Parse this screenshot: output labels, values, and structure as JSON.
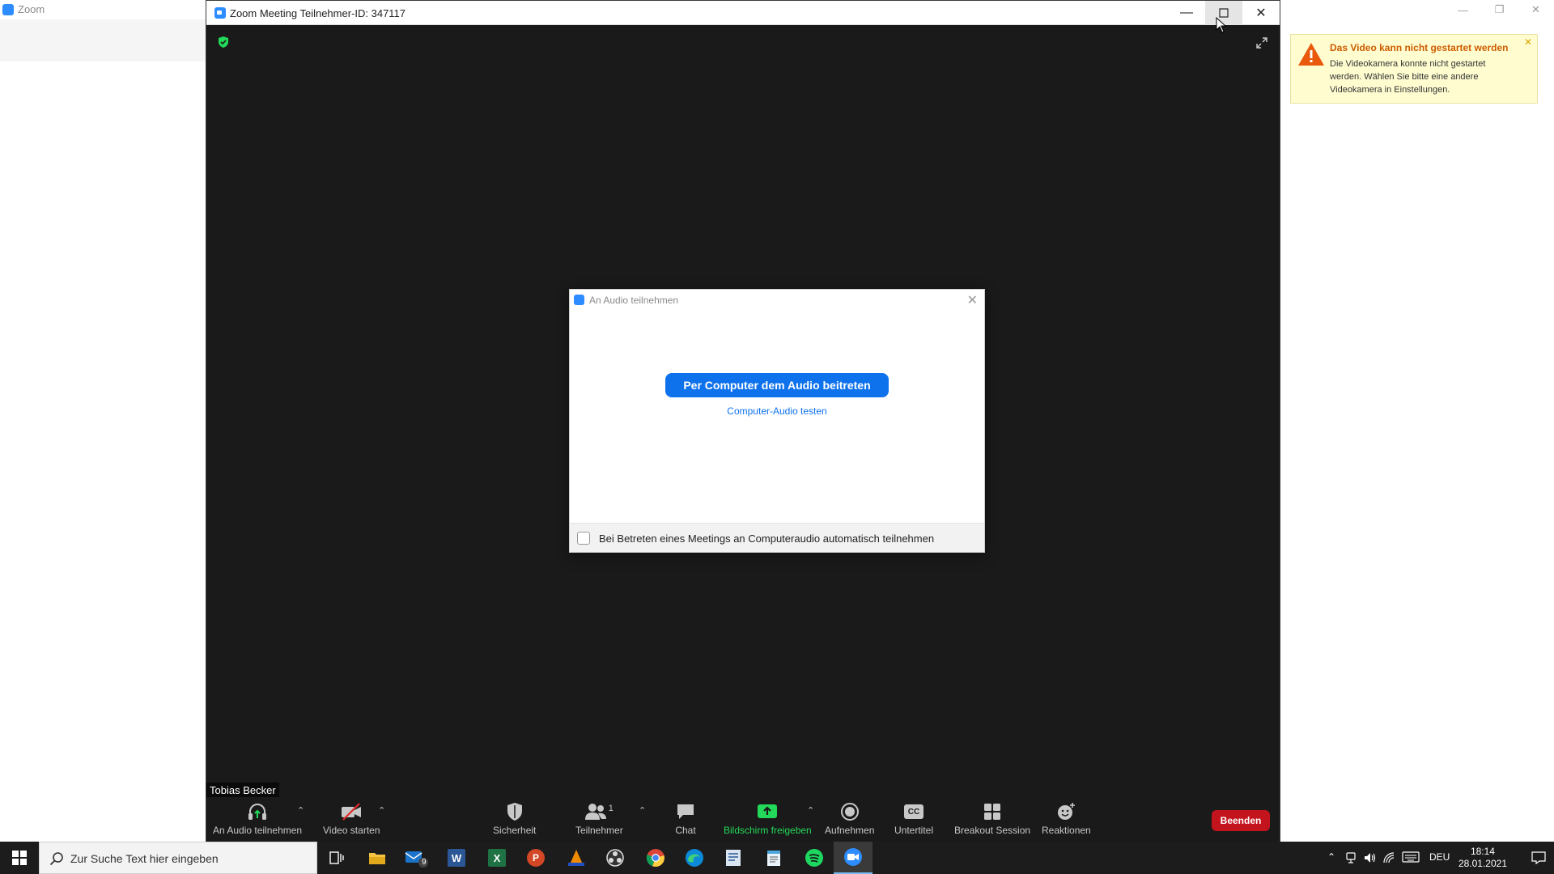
{
  "background_app": {
    "title": "Zoom"
  },
  "meeting_window": {
    "title": "Zoom Meeting Teilnehmer-ID: 347117"
  },
  "audio_dialog": {
    "title": "An Audio teilnehmen",
    "join_button": "Per Computer dem Audio beitreten",
    "test_link": "Computer-Audio testen",
    "auto_join_label": "Bei Betreten eines Meetings an Computeraudio automatisch teilnehmen"
  },
  "participant_name": "Tobias Becker",
  "toolbar": {
    "audio": "An Audio teilnehmen",
    "video": "Video starten",
    "security": "Sicherheit",
    "participants": "Teilnehmer",
    "participants_count": "1",
    "chat": "Chat",
    "share": "Bildschirm freigeben",
    "record": "Aufnehmen",
    "captions": "Untertitel",
    "captions_badge": "CC",
    "breakout": "Breakout Session",
    "reactions": "Reaktionen",
    "end": "Beenden"
  },
  "notification": {
    "title": "Das Video kann nicht gestartet werden",
    "body": "Die Videokamera konnte nicht gestartet werden. Wählen Sie bitte eine andere Videokamera in Einstellungen."
  },
  "taskbar": {
    "search_placeholder": "Zur Suche Text hier eingeben",
    "mail_badge": "9",
    "language": "DEU",
    "time": "18:14",
    "date": "28.01.2021"
  },
  "colors": {
    "zoom_blue": "#0e72ed",
    "end_red": "#c3141d",
    "share_green": "#23d959",
    "warning_orange": "#e8590c"
  }
}
